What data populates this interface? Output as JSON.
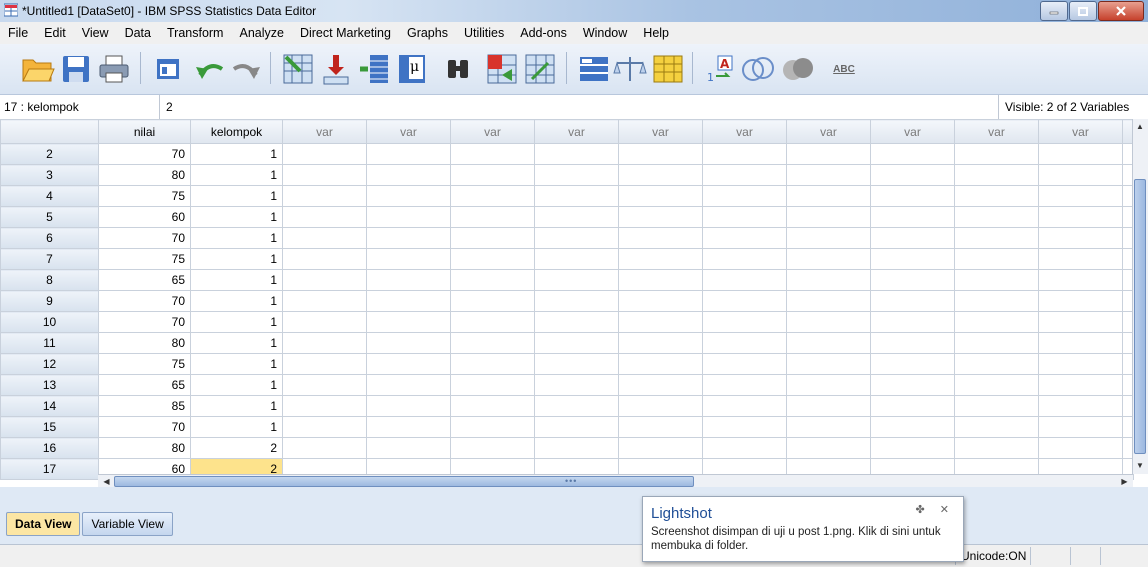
{
  "window": {
    "title": "*Untitled1 [DataSet0] - IBM SPSS Statistics Data Editor"
  },
  "menu": [
    "File",
    "Edit",
    "View",
    "Data",
    "Transform",
    "Analyze",
    "Direct Marketing",
    "Graphs",
    "Utilities",
    "Add-ons",
    "Window",
    "Help"
  ],
  "toolbar": {
    "icons": [
      "open-icon",
      "save-icon",
      "print-icon",
      "recall-dialog-icon",
      "undo-icon",
      "redo-icon",
      "goto-case-icon",
      "goto-variable-icon",
      "variables-icon",
      "run-descriptives-icon",
      "find-icon",
      "insert-cases-icon",
      "insert-variable-icon",
      "split-file-icon",
      "weight-cases-icon",
      "select-cases-icon",
      "value-labels-icon",
      "use-sets-icon",
      "show-all-variables-icon",
      "spell-check-icon"
    ],
    "spell_label": "ABC"
  },
  "cell_editor": {
    "reference": "17 : kelompok",
    "value": "2",
    "visible_info": "Visible: 2 of 2 Variables"
  },
  "grid": {
    "columns": [
      "nilai",
      "kelompok",
      "var",
      "var",
      "var",
      "var",
      "var",
      "var",
      "var",
      "var",
      "var",
      "var"
    ],
    "rows": [
      {
        "n": "2",
        "nilai": "70",
        "kelompok": "1"
      },
      {
        "n": "3",
        "nilai": "80",
        "kelompok": "1"
      },
      {
        "n": "4",
        "nilai": "75",
        "kelompok": "1"
      },
      {
        "n": "5",
        "nilai": "60",
        "kelompok": "1"
      },
      {
        "n": "6",
        "nilai": "70",
        "kelompok": "1"
      },
      {
        "n": "7",
        "nilai": "75",
        "kelompok": "1"
      },
      {
        "n": "8",
        "nilai": "65",
        "kelompok": "1"
      },
      {
        "n": "9",
        "nilai": "70",
        "kelompok": "1"
      },
      {
        "n": "10",
        "nilai": "70",
        "kelompok": "1"
      },
      {
        "n": "11",
        "nilai": "80",
        "kelompok": "1"
      },
      {
        "n": "12",
        "nilai": "75",
        "kelompok": "1"
      },
      {
        "n": "13",
        "nilai": "65",
        "kelompok": "1"
      },
      {
        "n": "14",
        "nilai": "85",
        "kelompok": "1"
      },
      {
        "n": "15",
        "nilai": "70",
        "kelompok": "1"
      },
      {
        "n": "16",
        "nilai": "80",
        "kelompok": "2"
      },
      {
        "n": "17",
        "nilai": "60",
        "kelompok": "2"
      }
    ]
  },
  "tabs": {
    "data_view": "Data View",
    "variable_view": "Variable View"
  },
  "status": {
    "unicode": "Unicode:ON"
  },
  "popup": {
    "title": "Lightshot",
    "message": "Screenshot disimpan di uji u post 1.png. Klik di sini untuk membuka di folder.",
    "controls": "✤ ✕"
  },
  "colors": {
    "selected_cell": "#fde38c",
    "active_tab": "#fce6a4",
    "popup_title": "#1f4e96"
  }
}
